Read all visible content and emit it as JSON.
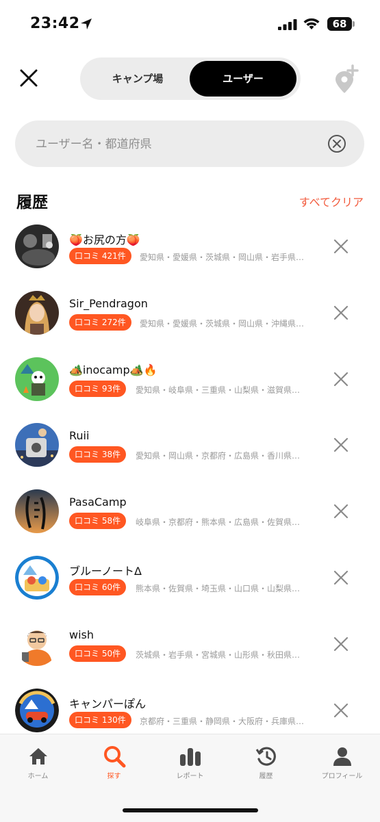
{
  "status": {
    "time": "23:42",
    "battery": "68"
  },
  "header": {
    "segments": [
      "キャンプ場",
      "ユーザー"
    ],
    "active_segment": "ユーザー"
  },
  "search": {
    "placeholder": "ユーザー名・都道府県",
    "value": ""
  },
  "history": {
    "title": "履歴",
    "clear_all": "すべてクリア"
  },
  "colors": {
    "accent": "#ff5722",
    "clear_all": "#f25a3c",
    "segment_active": "#000000"
  },
  "users": [
    {
      "name": "🍑お尻の方🍑",
      "reviews": "口コミ 421件",
      "prefectures": "愛知県・愛媛県・茨城県・岡山県・岩手県…"
    },
    {
      "name": "Sir_Pendragon",
      "reviews": "口コミ 272件",
      "prefectures": "愛知県・愛媛県・茨城県・岡山県・沖縄県…"
    },
    {
      "name": "🏕️inocamp🏕️🔥",
      "reviews": "口コミ 93件",
      "prefectures": "愛知県・岐阜県・三重県・山梨県・滋賀県…"
    },
    {
      "name": "Ruii",
      "reviews": "口コミ 38件",
      "prefectures": "愛知県・岡山県・京都府・広島県・香川県…"
    },
    {
      "name": "PasaCamp",
      "reviews": "口コミ 58件",
      "prefectures": "岐阜県・京都府・熊本県・広島県・佐賀県…"
    },
    {
      "name": "ブルーノートΔ",
      "reviews": "口コミ 60件",
      "prefectures": "熊本県・佐賀県・埼玉県・山口県・山梨県…"
    },
    {
      "name": "wish",
      "reviews": "口コミ 50件",
      "prefectures": "茨城県・岩手県・宮城県・山形県・秋田県…"
    },
    {
      "name": "キャンパーぽん",
      "reviews": "口コミ 130件",
      "prefectures": "京都府・三重県・静岡県・大阪府・兵庫県…"
    }
  ],
  "tabs": [
    {
      "label": "ホーム",
      "icon": "home-icon"
    },
    {
      "label": "探す",
      "icon": "search-icon"
    },
    {
      "label": "レポート",
      "icon": "bar-chart-icon"
    },
    {
      "label": "履歴",
      "icon": "history-icon"
    },
    {
      "label": "プロフィール",
      "icon": "person-icon"
    }
  ],
  "active_tab": "探す"
}
